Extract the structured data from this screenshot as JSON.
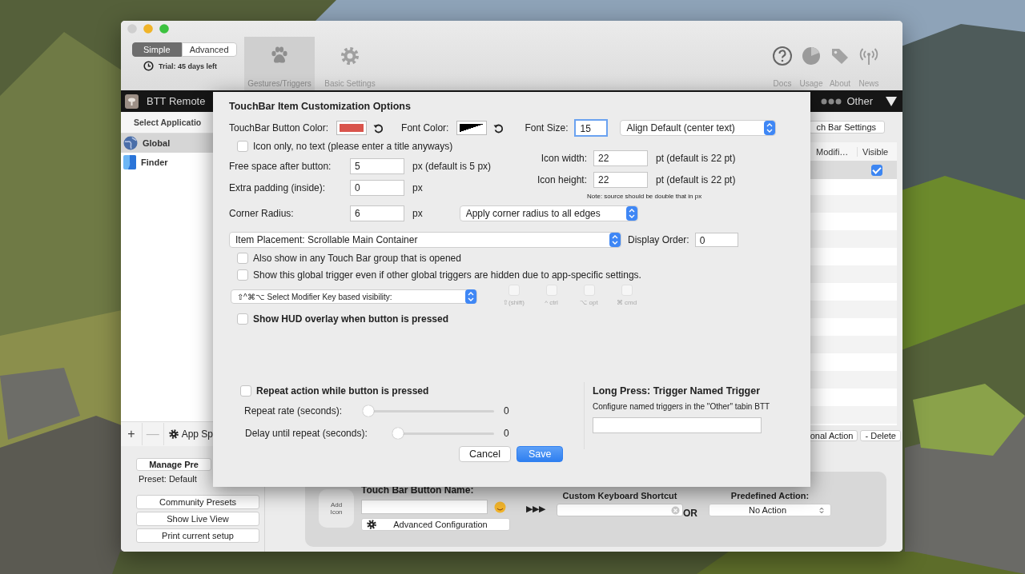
{
  "window": {
    "mode_switch": [
      {
        "label": "Simple",
        "selected": true
      },
      {
        "label": "Advanced",
        "selected": false
      }
    ],
    "trial": "Trial: 45 days left",
    "toolbar_tabs": [
      {
        "label": "Gestures/Triggers",
        "kind": "paw",
        "selected": true
      },
      {
        "label": "Basic Settings",
        "kind": "gear",
        "selected": false
      }
    ],
    "toolbar_links": [
      {
        "label": "Docs",
        "kind": "help"
      },
      {
        "label": "Usage",
        "kind": "pie"
      },
      {
        "label": "About",
        "kind": "tag"
      },
      {
        "label": "News",
        "kind": "antenna"
      }
    ]
  },
  "device_bar": {
    "device": "BTT Remote",
    "group": "Other"
  },
  "sidebar": {
    "header": "Select Applicatio",
    "apps": [
      {
        "name": "Global",
        "kind": "globe",
        "selected": true
      },
      {
        "name": "Finder",
        "kind": "finder",
        "selected": false
      }
    ],
    "list_buttons": [
      {
        "label": "+",
        "disabled": false
      },
      {
        "label": "—",
        "disabled": true
      }
    ],
    "app_settings": "App Sp"
  },
  "presets": {
    "manage": "Manage Pre",
    "current": "Preset: Default",
    "buttons": [
      "Community Presets",
      "Show Live View",
      "Print current setup"
    ]
  },
  "triggers": {
    "settings_button": "ch Bar Settings",
    "columns": [
      "Modifi…",
      "Visible"
    ],
    "rows": [
      {
        "visible": true,
        "selected": true
      }
    ],
    "buttons": [
      "onal Action",
      "- Delete"
    ]
  },
  "editor": {
    "name_label": "Touch Bar Button Name:",
    "add_icon": "Add Icon",
    "arrows": "▶▶▶",
    "shortcut_label": "Custom Keyboard Shortcut",
    "or": "OR",
    "action_label": "Predefined Action:",
    "action_value": "No Action",
    "advanced": "Advanced Configuration"
  },
  "sheet": {
    "title": "TouchBar Item Customization Options",
    "button_color": {
      "label": "TouchBar Button Color:",
      "color": "#d9544c"
    },
    "font_color": {
      "label": "Font Color:",
      "color": "#000000"
    },
    "font_size": {
      "label": "Font Size:",
      "value": "15",
      "focused": true
    },
    "align": "Align Default (center text)",
    "icon_only": {
      "label": "Icon only, no text (please enter a title anyways)",
      "checked": false
    },
    "spacing_fields": [
      {
        "label": "Free space after button:",
        "value": "5",
        "unit": "px (default is 5 px)"
      },
      {
        "label": "Extra padding (inside):",
        "value": "0",
        "unit": "px"
      }
    ],
    "corner": {
      "label": "Corner Radius:",
      "value": "6",
      "unit": "px",
      "mode": "Apply corner radius to all edges"
    },
    "icon_fields": [
      {
        "label": "Icon width:",
        "value": "22",
        "unit": "pt (default is 22 pt)"
      },
      {
        "label": "Icon height:",
        "value": "22",
        "unit": "pt (default is 22 pt)"
      }
    ],
    "icon_note": "Note: source should be double that in px",
    "placement": "Item Placement: Scrollable Main Container",
    "display_order": {
      "label": "Display Order:",
      "value": "0"
    },
    "options": [
      {
        "label": "Also show in any Touch Bar group that is opened",
        "checked": false
      },
      {
        "label": "Show this global trigger even if other global triggers are hidden due to app-specific settings.",
        "checked": false
      }
    ],
    "modifier_select": "⇧^⌘⌥ Select Modifier Key based visibility:",
    "modifiers": [
      {
        "label": "⇧(shift)",
        "checked": false,
        "disabled": true
      },
      {
        "label": "^ ctrl",
        "checked": false,
        "disabled": true
      },
      {
        "label": "⌥ opt",
        "checked": false,
        "disabled": true
      },
      {
        "label": "⌘ cmd",
        "checked": false,
        "disabled": true
      }
    ],
    "hud": {
      "label": "Show HUD overlay when button is pressed",
      "checked": false
    },
    "repeat": {
      "label": "Repeat action while button is pressed",
      "checked": false
    },
    "sliders": [
      {
        "label": "Repeat rate (seconds):",
        "level": 0,
        "reading": "0"
      },
      {
        "label": "Delay until repeat (seconds):",
        "level": 0,
        "reading": "0"
      }
    ],
    "long_press": {
      "title": "Long Press: Trigger Named Trigger",
      "hint": "Configure named triggers in the \"Other\" tabin BTT"
    },
    "buttons": [
      {
        "label": "Cancel",
        "kind": "default"
      },
      {
        "label": "Save",
        "kind": "primary"
      }
    ]
  }
}
